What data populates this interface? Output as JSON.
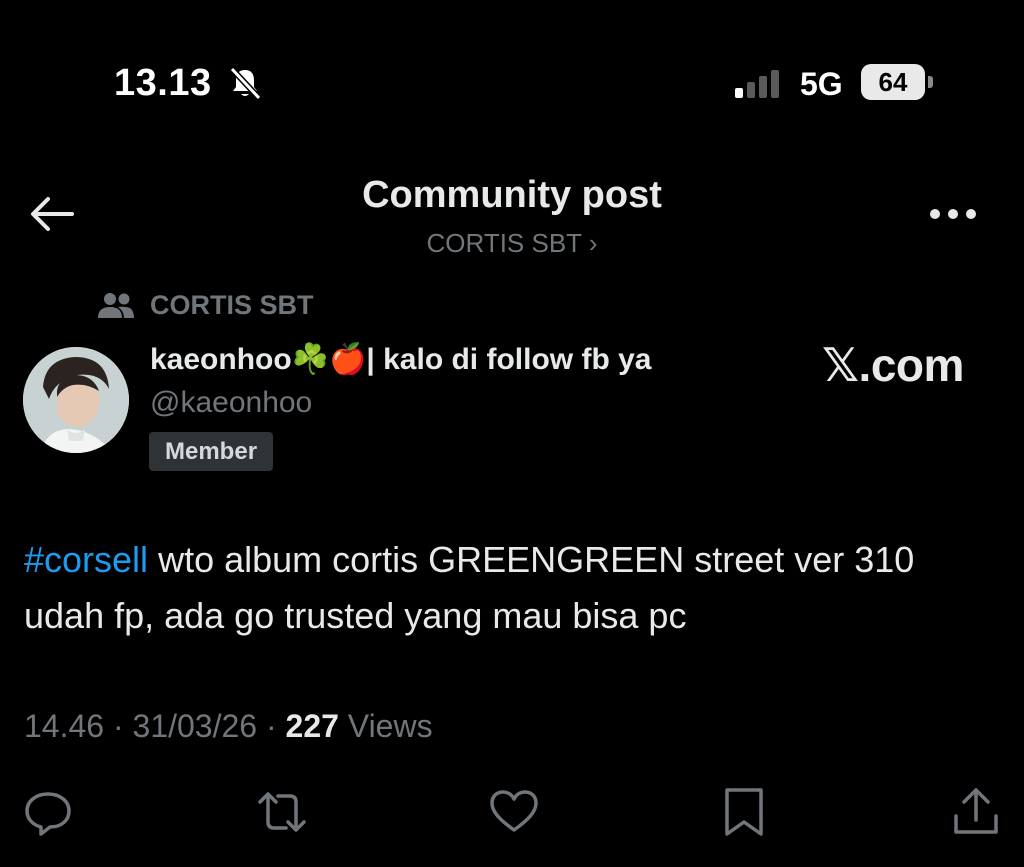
{
  "status_bar": {
    "time": "13.13",
    "network": "5G",
    "battery": "64",
    "icons": [
      "bell-muted-icon",
      "signal-icon",
      "battery-icon"
    ]
  },
  "header": {
    "title": "Community post",
    "community_link": "CORTIS SBT ›",
    "back_icon": "arrow-left-icon",
    "more_icon": "more-horizontal-icon"
  },
  "post": {
    "community_name": "CORTIS SBT",
    "author": {
      "display_name": "kaeonhoo☘️🍎| kalo di follow fb ya",
      "handle": "@kaeonhoo",
      "badge": "Member"
    },
    "watermark": "𝕏.com",
    "hashtag": "#corsell",
    "text": " wto album cortis GREENGREEN street ver 310 udah fp, ada go trusted yang mau bisa pc",
    "meta": {
      "time": "14.46",
      "separator": " · ",
      "date": "31/03/26",
      "views_count": "227",
      "views_label": " Views"
    }
  },
  "actions": [
    "reply-icon",
    "repost-icon",
    "like-icon",
    "bookmark-icon",
    "share-icon"
  ],
  "colors": {
    "background": "#000000",
    "text_primary": "#e7e9ea",
    "text_secondary": "#71767b",
    "accent_link": "#1d9bf0",
    "badge_bg": "#2f3336"
  }
}
